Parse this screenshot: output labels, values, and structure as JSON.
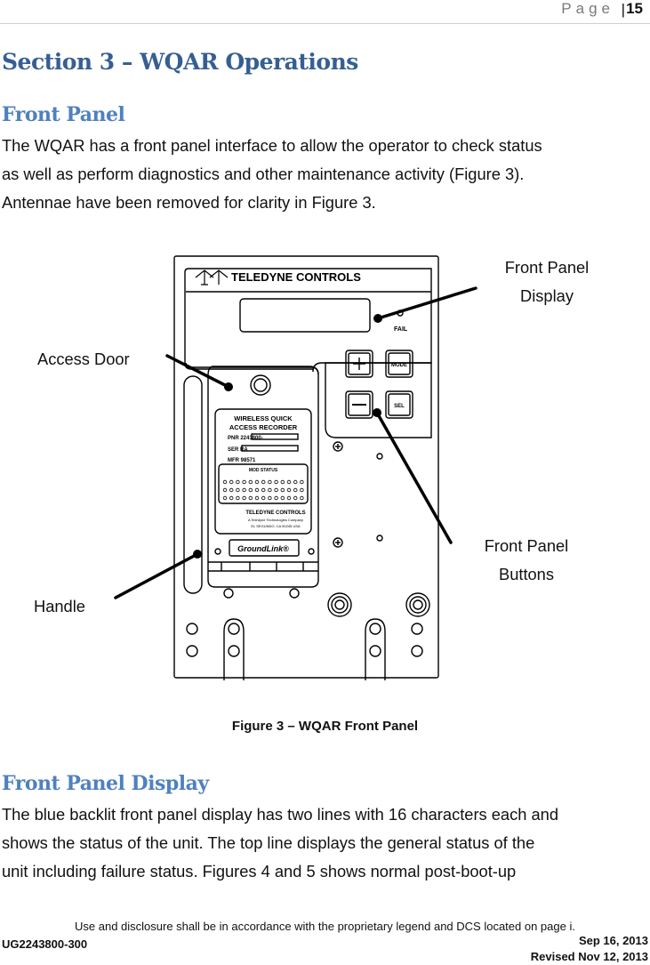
{
  "header": {
    "page_label": "Page",
    "page_separator": "|",
    "page_number": "15"
  },
  "section_title": "Section 3 – WQAR Operations",
  "front_panel": {
    "heading": "Front Panel",
    "paragraph_lines": [
      "The WQAR has a front panel interface to allow the operator to check status",
      "as well as perform diagnostics and other maintenance activity (Figure 3).",
      "Antennae have been removed for clarity in Figure 3."
    ]
  },
  "figure": {
    "callouts": {
      "display_line1": "Front Panel",
      "display_line2": "Display",
      "access_door": "Access Door",
      "buttons_line1": "Front Panel",
      "buttons_line2": "Buttons",
      "handle": "Handle"
    },
    "device": {
      "brand": "TELEDYNE CONTROLS",
      "fail_label": "FAIL",
      "buttons": [
        "+",
        "MODE",
        "—",
        "SEL"
      ],
      "label_title_line1": "WIRELESS QUICK",
      "label_title_line2": "ACCESS RECORDER",
      "pnr": "PNR 2243800-",
      "ser": "SER RA",
      "mfr": "MFR 98571",
      "mod_status": "MOD STATUS",
      "label_brand": "TELEDYNE CONTROLS",
      "label_sub1": "A Teledyne Technologies Company",
      "label_sub2": "EL SEGUNDO, CA 90245 USA",
      "groundlink": "GroundLink®"
    },
    "caption": "Figure 3 – WQAR Front Panel"
  },
  "front_panel_display": {
    "heading": "Front Panel Display",
    "paragraph_lines": [
      "The blue backlit front panel display has two lines with 16 characters each and",
      "shows the status of the unit.  The top line displays the general status of the",
      "unit including failure status. Figures 4 and 5 shows normal post-boot-up"
    ]
  },
  "footer": {
    "disclosure": "Use and disclosure shall be in accordance with the proprietary legend and DCS located on page i.",
    "doc_number": "UG2243800-300",
    "date": "Sep 16, 2013",
    "revised": "Revised Nov 12, 2013"
  }
}
